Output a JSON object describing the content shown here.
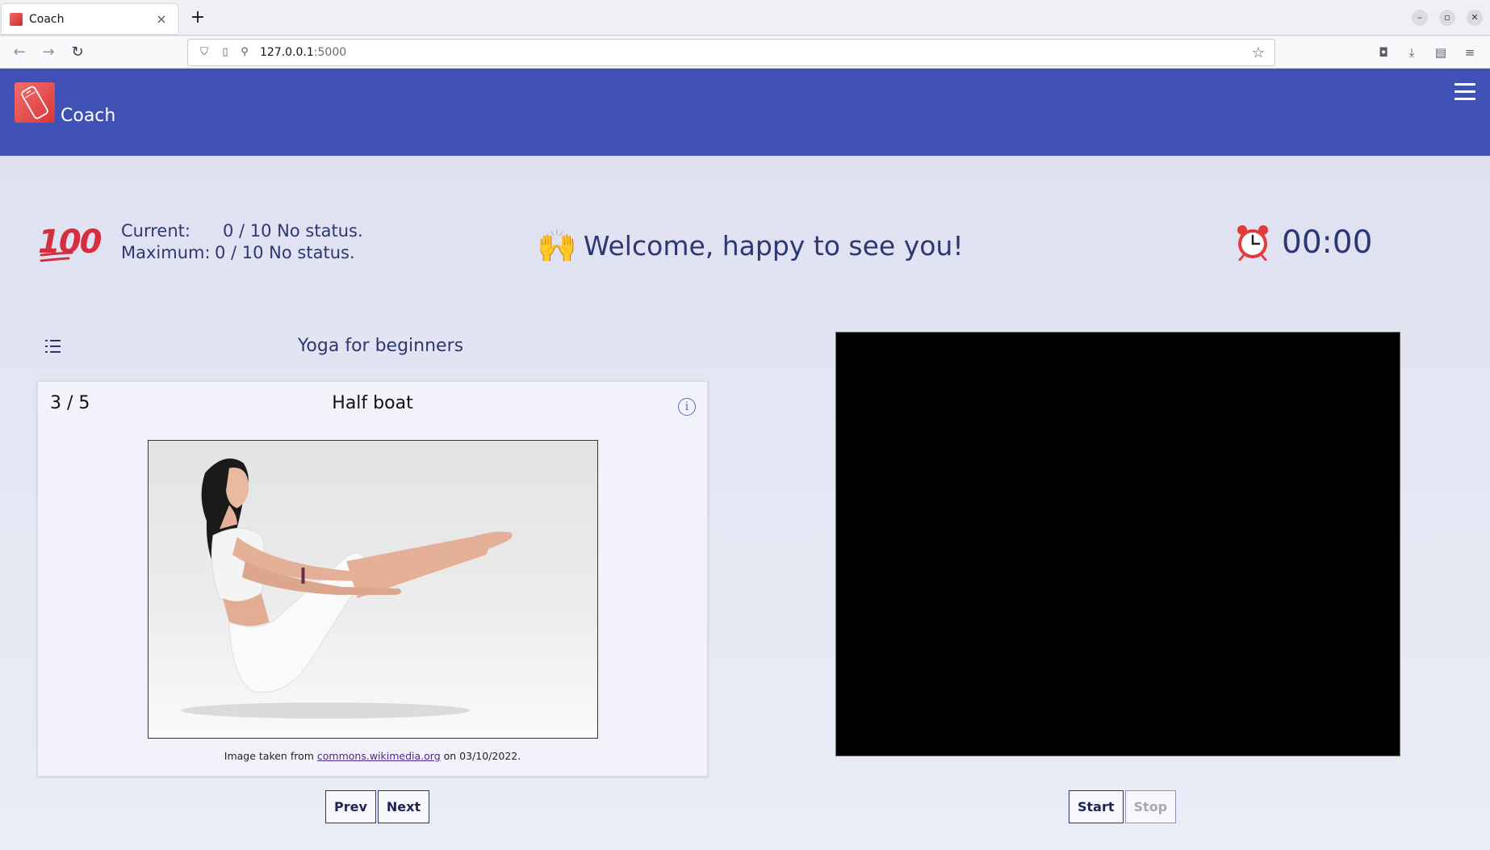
{
  "browser": {
    "tab_title": "Coach",
    "tab_close": "×",
    "new_tab": "+",
    "url_host": "127.0.0.1",
    "url_port": ":5000",
    "window_controls": [
      "–",
      "▫",
      "✕"
    ]
  },
  "header": {
    "app_title": "Coach",
    "logo_icon": "phone-logo-icon",
    "menu_icon": "hamburger-menu-icon",
    "color": "#3f51b5"
  },
  "score": {
    "icon": "100",
    "current_label": "Current:",
    "current_value": "0 / 10 No status.",
    "maximum_label": "Maximum:",
    "maximum_value": "0 / 10 No status."
  },
  "welcome": {
    "icon": "🙌",
    "text": "Welcome, happy to see you!"
  },
  "timer": {
    "icon": "alarm-clock-icon",
    "value": "00:00"
  },
  "program": {
    "list_icon": "list-icon",
    "title": "Yoga for beginners"
  },
  "exercise": {
    "counter": "3 / 5",
    "title": "Half boat",
    "info_icon": "i",
    "credit_prefix": "Image taken from",
    "credit_link": "commons.wikimedia.org",
    "credit_suffix": "on 03/10/2022."
  },
  "nav_buttons": {
    "prev": "Prev",
    "next": "Next"
  },
  "video_buttons": {
    "start": "Start",
    "stop": "Stop"
  }
}
